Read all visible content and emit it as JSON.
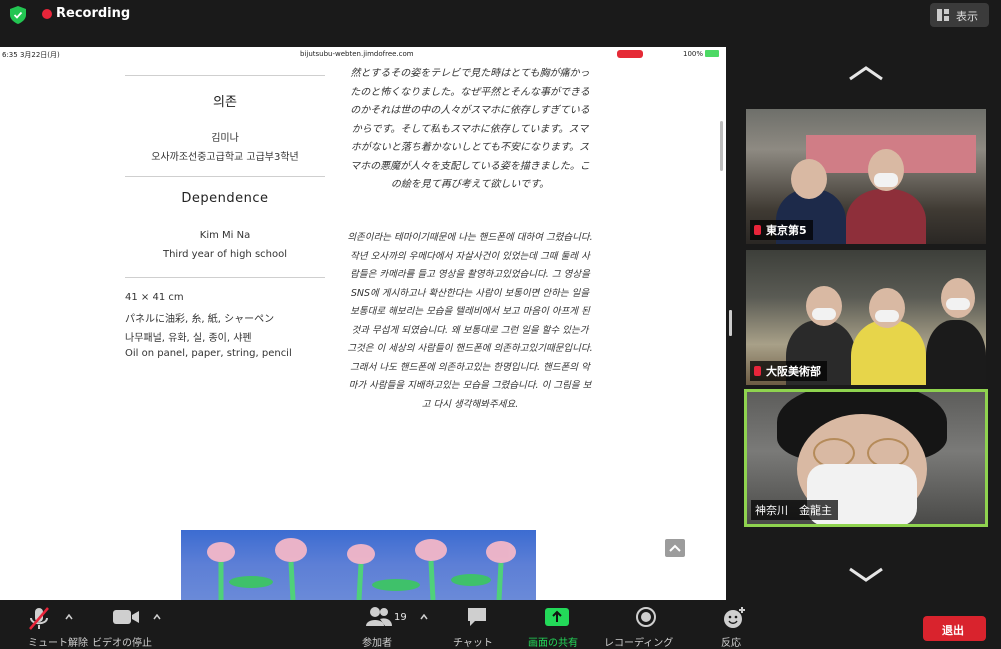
{
  "top_bar": {
    "recording_label": "Recording",
    "view_label": "表示"
  },
  "shared_screen": {
    "status_bar": {
      "time": "6:35  3月22日(月)",
      "url": "bijutsubu-webten.jimdofree.com",
      "battery": "100%"
    },
    "artwork": {
      "ko_title": "의존",
      "ko_artist": "김미나",
      "ko_school": "오사까조선중고급학교    고급부3학년",
      "en_title": "Dependence",
      "en_artist": "Kim Mi Na",
      "en_school": "Third year of high school",
      "size": "41 × 41 cm",
      "medium_jp": "パネルに油彩, 糸, 紙, シャーペン",
      "medium_ko": "나무패널, 유화, 실, 종이, 샤펜",
      "medium_en": "Oil on panel, paper, string, pencil"
    },
    "jp_description": "然とするその姿をテレビで見た時はとても胸が痛かったのと怖くなりました。なぜ平然とそんな事ができるのかそれは世の中の人々がスマホに依存しすぎているからです。そして私もスマホに依存しています。スマホがないと落ち着かないしとても不安になります。スマホの悪魔が人々を支配している姿を描きました。この絵を見て再び考えて欲しいです。",
    "ko_description": "의존이라는 테마이기때문에 나는 핸드폰에 대하여 그렸습니다. 작년 오사까의 우메다에서 자살사건이 있었는데 그때 둘레 사람들은 카메라를 들고 영상을 촬영하고있었습니다. 그 영상을 SNS에 게시하고나 확산한다는 사람이 보통이면 안하는 일을 보통대로 해보리는 모습을 텔레비에서 보고 마음이 아프게 된것과 무섭게 되였습니다. 왜 보통대로 그런 일을 할수 있는가 그것은 이 세상의 사람들이 핸드폰에 의존하고있기때문입니다. 그래서 나도 핸드폰에 의존하고있는 한명입니다. 핸드폰의 악마가 사람들을 지배하고있는 모습을 그렸습니다. 이 그림을 보고 다시 생각해봐주세요."
  },
  "participants": [
    {
      "name": "東京第5"
    },
    {
      "name": "大阪美術部"
    },
    {
      "name": "神奈川　金龍主"
    }
  ],
  "toolbar": {
    "mute_label": "ミュート解除",
    "video_label": "ビデオの停止",
    "participants_count": "19",
    "participants_label": "参加者",
    "chat_label": "チャット",
    "share_label": "画面の共有",
    "record_label": "レコーディング",
    "reactions_label": "反応",
    "leave_label": "退出"
  },
  "colors": {
    "recording": "#e8253a",
    "active_speaker_border": "#8fd34f",
    "share_icon": "#23d959",
    "leave_button": "#d9232d"
  }
}
